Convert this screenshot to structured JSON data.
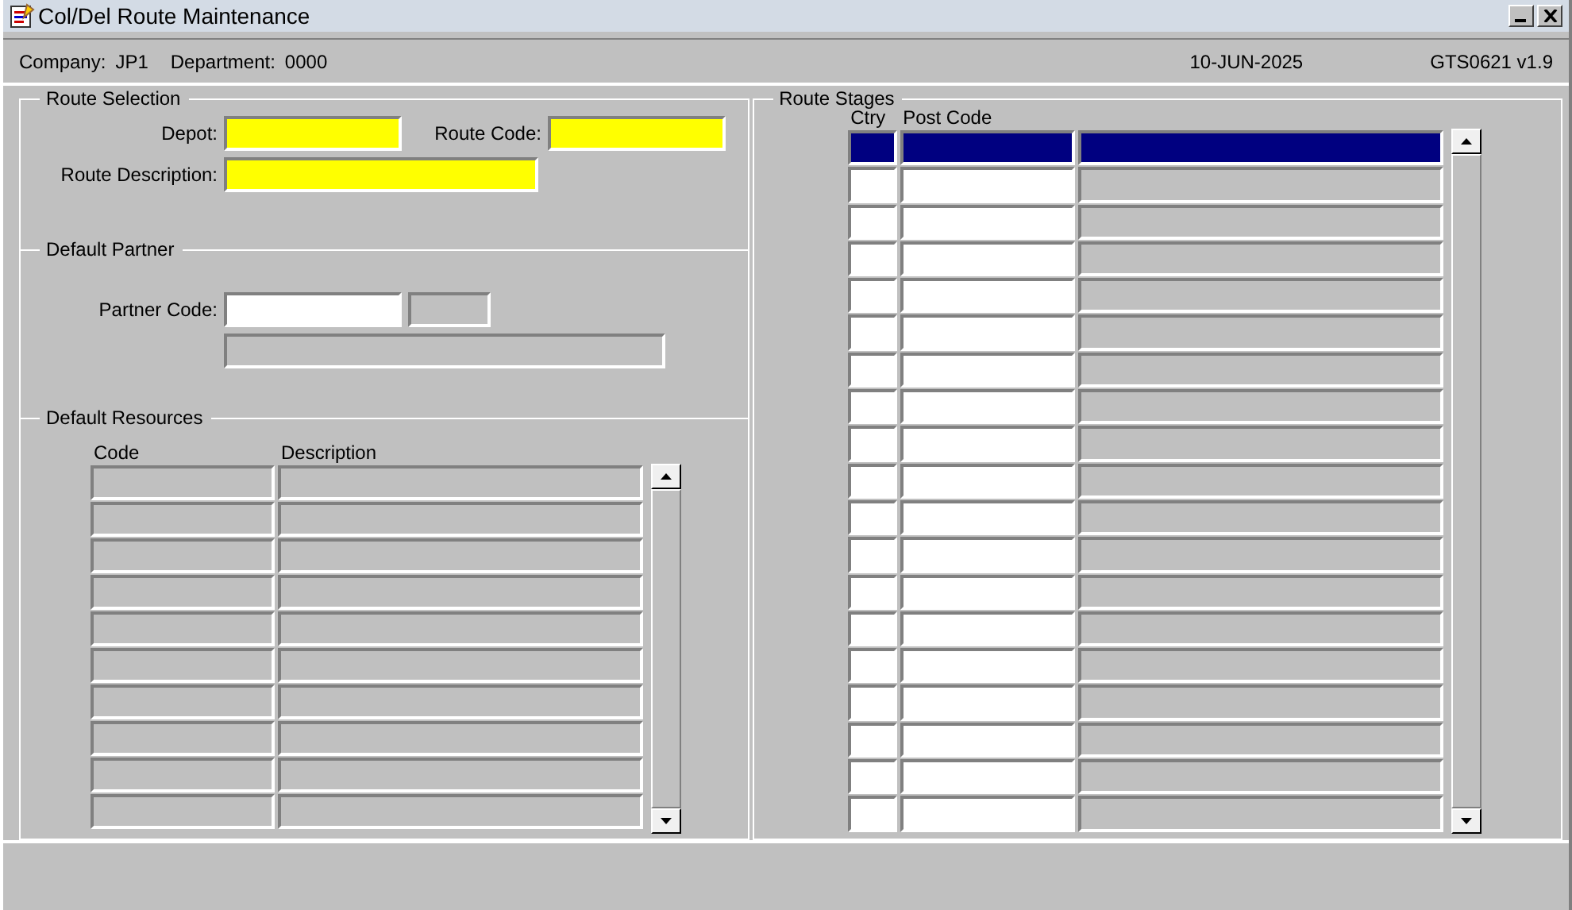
{
  "window": {
    "title": "Col/Del Route Maintenance",
    "buttons": [
      {
        "kind": "minimize"
      },
      {
        "kind": "close"
      }
    ]
  },
  "header": {
    "company_label": "Company:",
    "company": "JP1",
    "department_label": "Department:",
    "department": "0000",
    "date": "10-JUN-2025",
    "program": "GTS0621  v1.9"
  },
  "route_selection": {
    "title": "Route Selection",
    "fields": [
      {
        "label": "Depot:",
        "required": true
      },
      {
        "label": "Route Code:",
        "required": true
      },
      {
        "label": "Route Description:",
        "required": true
      }
    ]
  },
  "default_partner": {
    "title": "Default Partner",
    "label": "Partner Code:",
    "fields": [
      {
        "disabled": false
      },
      {
        "disabled": true
      },
      {
        "disabled": true
      }
    ]
  },
  "default_resources": {
    "title": "Default Resources",
    "columns": [
      {
        "label": "Code",
        "disabled": true
      },
      {
        "label": "Description",
        "disabled": true
      }
    ],
    "rows": [
      {
        "selected": false
      },
      {
        "selected": false
      },
      {
        "selected": false
      },
      {
        "selected": false
      },
      {
        "selected": false
      },
      {
        "selected": false
      },
      {
        "selected": false
      },
      {
        "selected": false
      },
      {
        "selected": false
      },
      {
        "selected": false
      }
    ]
  },
  "route_stages": {
    "title": "Route Stages",
    "columns": [
      {
        "label": "Ctry",
        "disabled": false
      },
      {
        "label": "Post Code",
        "disabled": false
      },
      {
        "disabled": true
      }
    ],
    "rows": [
      {
        "selected": true
      },
      {
        "selected": false
      },
      {
        "selected": false
      },
      {
        "selected": false
      },
      {
        "selected": false
      },
      {
        "selected": false
      },
      {
        "selected": false
      },
      {
        "selected": false
      },
      {
        "selected": false
      },
      {
        "selected": false
      },
      {
        "selected": false
      },
      {
        "selected": false
      },
      {
        "selected": false
      },
      {
        "selected": false
      },
      {
        "selected": false
      },
      {
        "selected": false
      },
      {
        "selected": false
      },
      {
        "selected": false
      },
      {
        "selected": false
      }
    ]
  }
}
